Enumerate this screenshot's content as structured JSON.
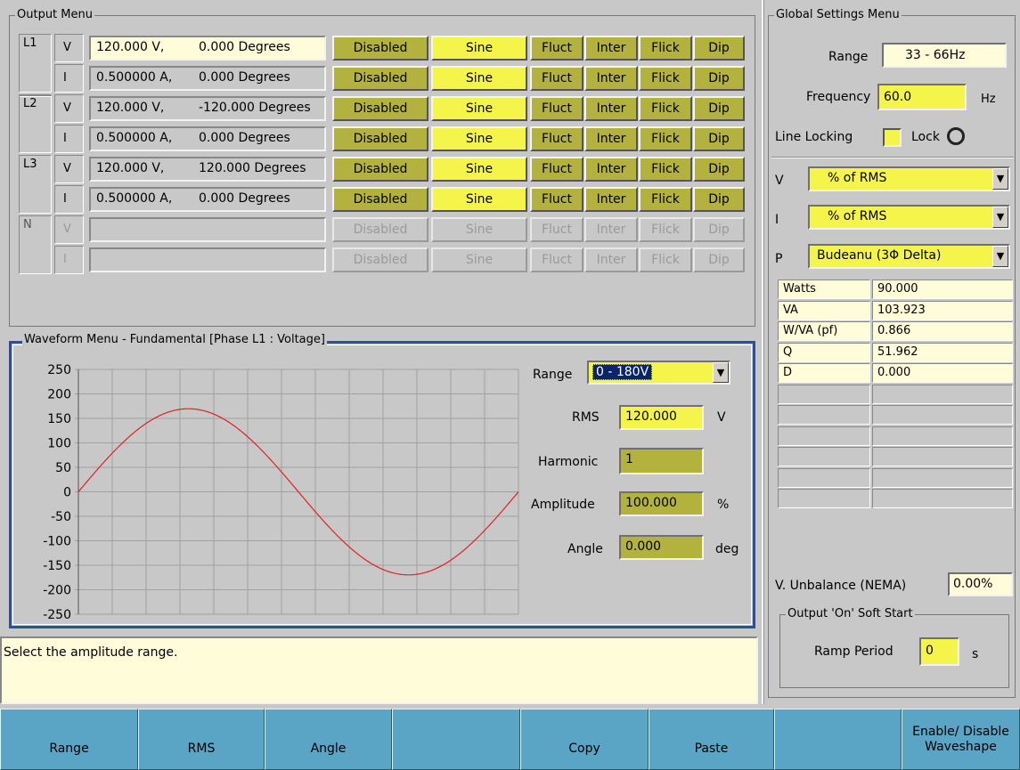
{
  "output_menu": {
    "title": "Output Menu",
    "rows": [
      {
        "phase": "L1",
        "type": "V",
        "value": "120.000 V,",
        "angle": "0.000 Degrees",
        "enabled": true,
        "selected": true
      },
      {
        "phase": "",
        "type": "I",
        "value": "0.500000 A,",
        "angle": "0.000 Degrees",
        "enabled": true,
        "selected": false
      },
      {
        "phase": "L2",
        "type": "V",
        "value": "120.000 V,",
        "angle": "-120.000 Degrees",
        "enabled": true,
        "selected": false
      },
      {
        "phase": "",
        "type": "I",
        "value": "0.500000 A,",
        "angle": "0.000 Degrees",
        "enabled": true,
        "selected": false
      },
      {
        "phase": "L3",
        "type": "V",
        "value": "120.000 V,",
        "angle": "120.000 Degrees",
        "enabled": true,
        "selected": false
      },
      {
        "phase": "",
        "type": "I",
        "value": "0.500000 A,",
        "angle": "0.000 Degrees",
        "enabled": true,
        "selected": false
      },
      {
        "phase": "N",
        "type": "V",
        "value": "",
        "angle": "",
        "enabled": false,
        "selected": false
      },
      {
        "phase": "",
        "type": "I",
        "value": "",
        "angle": "",
        "enabled": false,
        "selected": false
      }
    ],
    "buttons": {
      "disabled": "Disabled",
      "sine": "Sine",
      "fluct": "Fluct",
      "inter": "Inter",
      "flick": "Flick",
      "dip": "Dip"
    }
  },
  "waveform_menu": {
    "title": "Waveform Menu - Fundamental [Phase L1 : Voltage]",
    "range_label": "Range",
    "range_value": "0 - 180V",
    "rms_label": "RMS",
    "rms_value": "120.000",
    "rms_unit": "V",
    "harmonic_label": "Harmonic",
    "harmonic_value": "1",
    "amplitude_label": "Amplitude",
    "amplitude_value": "100.000",
    "amplitude_unit": "%",
    "angle_label": "Angle",
    "angle_value": "0.000",
    "angle_unit": "deg"
  },
  "chart_data": {
    "type": "line",
    "title": "",
    "xlabel": "",
    "ylabel": "",
    "ylim": [
      -250,
      250
    ],
    "yticks": [
      "250",
      "200",
      "150",
      "100",
      "50",
      "0",
      "-50",
      "-100",
      "-150",
      "-200",
      "-250"
    ],
    "grid": true,
    "series": [
      {
        "color": "#e02020",
        "amplitude": 169.7,
        "cycles": 1,
        "phase_deg": 0
      }
    ]
  },
  "status_text": "Select the amplitude range.",
  "global_settings": {
    "title": "Global Settings Menu",
    "range_label": "Range",
    "range_value": "33 - 66Hz",
    "frequency_label": "Frequency",
    "frequency_value": "60.0",
    "frequency_unit": "Hz",
    "line_locking_label": "Line Locking",
    "lock_label": "Lock",
    "v_label": "V",
    "v_mode": "% of RMS",
    "i_label": "I",
    "i_mode": "% of RMS",
    "p_label": "P",
    "p_mode": "Budeanu (3Φ Delta)",
    "power": [
      {
        "name": "Watts",
        "value": "90.000"
      },
      {
        "name": "VA",
        "value": "103.923"
      },
      {
        "name": "W/VA (pf)",
        "value": "0.866"
      },
      {
        "name": "Q",
        "value": "51.962"
      },
      {
        "name": "D",
        "value": "0.000"
      }
    ],
    "unbalance_label": "V. Unbalance (NEMA)",
    "unbalance_value": "0.00%",
    "soft_start_title": "Output 'On' Soft Start",
    "ramp_label": "Ramp Period",
    "ramp_value": "0",
    "ramp_unit": "s"
  },
  "function_keys": [
    "Range",
    "RMS",
    "Angle",
    "",
    "Copy",
    "Paste",
    "",
    "Enable/ Disable Waveshape"
  ],
  "colors": {
    "olive": "#b3b23e",
    "yellow": "#f4f44a",
    "cream": "#fffcd9",
    "fkey": "#5aa4c6",
    "wave": "#e02020",
    "panel_border": "#2a4fa0"
  }
}
